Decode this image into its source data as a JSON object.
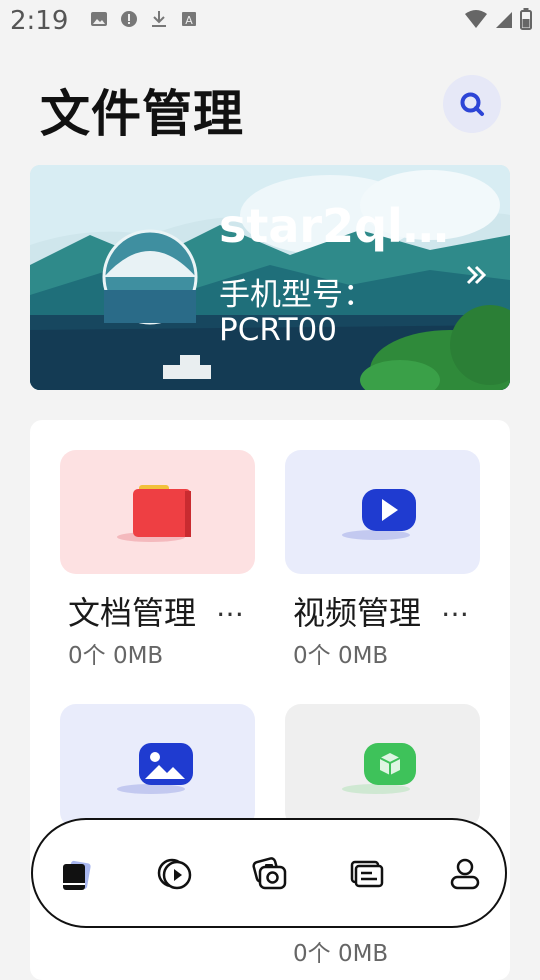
{
  "status_bar": {
    "time": "2:19",
    "left_icons": [
      "image-icon",
      "alert-icon",
      "download-icon",
      "keyboard-icon"
    ],
    "right_icons": [
      "wifi-icon",
      "signal-icon",
      "battery-icon"
    ]
  },
  "header": {
    "title": "文件管理",
    "search_icon": "search-icon"
  },
  "banner": {
    "name": "star2ql…",
    "model_label": "手机型号：",
    "model_value": "PCRT00",
    "arrow_icon": "double-chevron-right-icon"
  },
  "categories": [
    {
      "title": "文档管理",
      "more": "…",
      "meta": "0个  0MB",
      "icon": "folder-icon",
      "bg": "#fde1e2"
    },
    {
      "title": "视频管理",
      "more": "…",
      "meta": "0个  0MB",
      "icon": "video-play-icon",
      "bg": "#e9ecfb"
    },
    {
      "title": "",
      "more": "",
      "meta": "",
      "icon": "image-gallery-icon",
      "bg": "#e9ecfb"
    },
    {
      "title": "",
      "more": "",
      "meta": "0个  0MB",
      "icon": "package-box-icon",
      "bg": "#efefef"
    }
  ],
  "bottom_nav": [
    {
      "name": "nav-documents",
      "icon": "document-icon",
      "active": true
    },
    {
      "name": "nav-video",
      "icon": "video-icon",
      "active": false
    },
    {
      "name": "nav-photos",
      "icon": "camera-icon",
      "active": false
    },
    {
      "name": "nav-files",
      "icon": "files-icon",
      "active": false
    },
    {
      "name": "nav-profile",
      "icon": "user-icon",
      "active": false
    }
  ],
  "colors": {
    "accent": "#2d45d6",
    "title": "#111111",
    "background": "#f3f3f3"
  }
}
